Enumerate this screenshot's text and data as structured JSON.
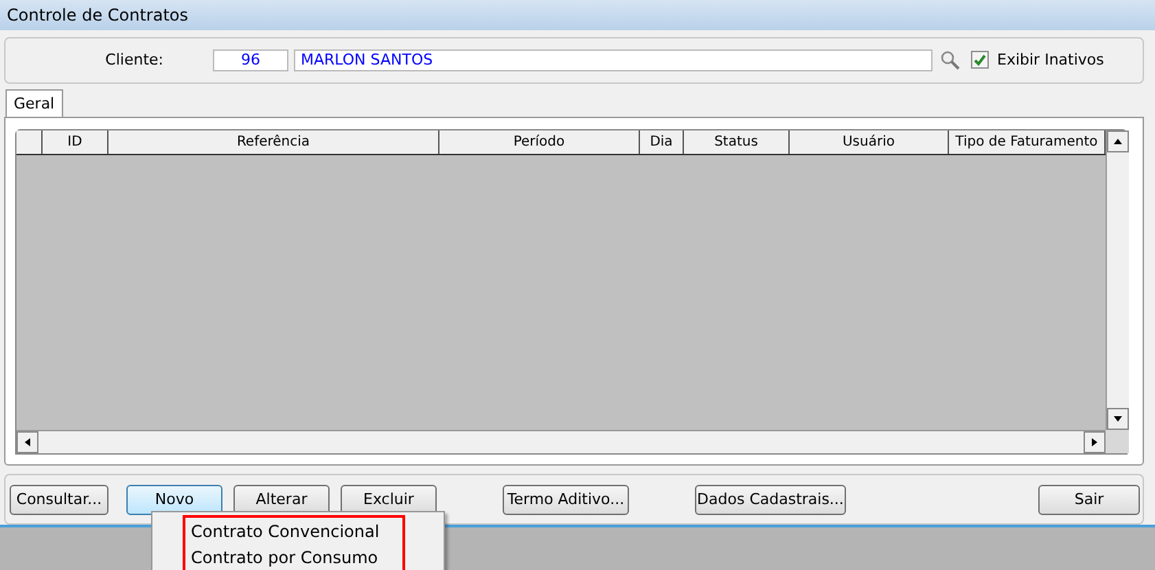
{
  "window": {
    "title": "Controle de Contratos"
  },
  "client": {
    "label": "Cliente:",
    "code": "96",
    "name": "MARLON SANTOS",
    "show_inactive": {
      "label": "Exibir Inativos",
      "checked": true
    }
  },
  "tabs": [
    {
      "label": "Geral",
      "selected": true
    }
  ],
  "table": {
    "columns": [
      "ID",
      "Referência",
      "Período",
      "Dia",
      "Status",
      "Usuário",
      "Tipo de Faturamento"
    ]
  },
  "buttons": [
    {
      "label": "Consultar..."
    },
    {
      "label": "Novo"
    },
    {
      "label": "Alterar"
    },
    {
      "label": "Excluir"
    },
    {
      "label": "Termo Aditivo..."
    },
    {
      "label": "Dados Cadastrais..."
    },
    {
      "label": "Sair"
    }
  ],
  "menu": {
    "items": [
      {
        "label": "Contrato Convencional"
      },
      {
        "label": "Contrato por Consumo"
      }
    ]
  }
}
